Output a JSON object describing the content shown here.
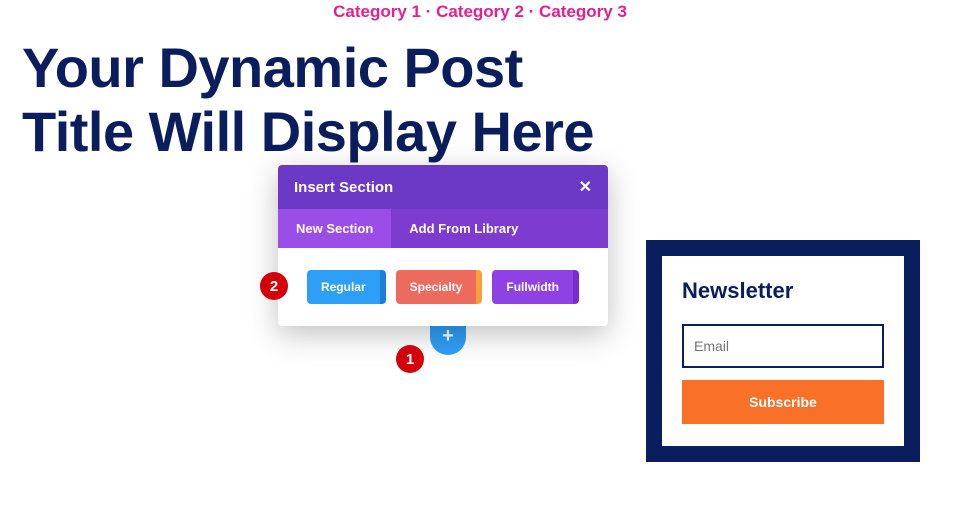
{
  "categories": "Category 1 · Category 2 · Category 3",
  "post_title": "Your Dynamic Post Title Will Display Here",
  "popup": {
    "title": "Insert Section",
    "close": "✕",
    "tabs": {
      "new_section": "New Section",
      "add_from_library": "Add From Library"
    },
    "buttons": {
      "regular": "Regular",
      "specialty": "Specialty",
      "fullwidth": "Fullwidth"
    }
  },
  "add_icon": "+",
  "steps": {
    "one": "1",
    "two": "2"
  },
  "newsletter": {
    "title": "Newsletter",
    "placeholder": "Email",
    "subscribe": "Subscribe"
  }
}
